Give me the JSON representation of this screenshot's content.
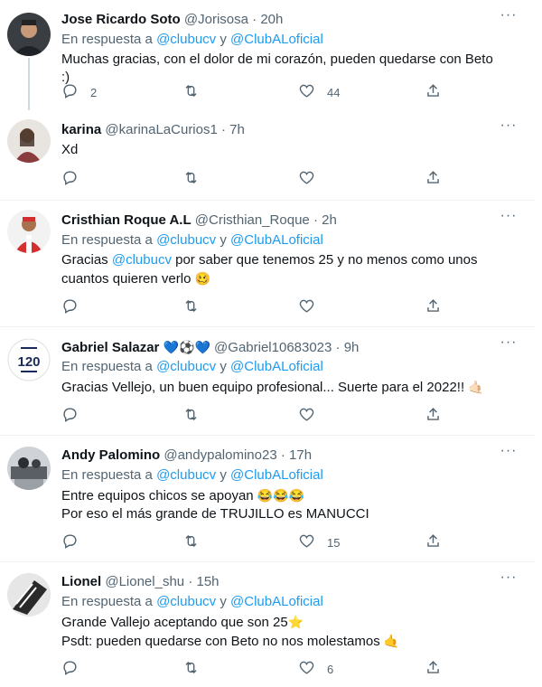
{
  "tweets": [
    {
      "name": "Jose Ricardo Soto",
      "handle": "@Jorisosa",
      "time": "20h",
      "reply_prefix": "En respuesta a",
      "reply_m1": "@clubucv",
      "reply_and": "y",
      "reply_m2": "@ClubALoficial",
      "line1": "Muchas gracias, con el dolor de mi corazón, pueden quedarse con Beto :)",
      "replies": "2",
      "likes": "44"
    },
    {
      "name": "karina",
      "handle": "@karinaLaCurios1",
      "time": "7h",
      "line1": "Xd"
    },
    {
      "name": "Cristhian Roque A.L",
      "handle": "@Cristhian_Roque",
      "time": "2h",
      "reply_prefix": "En respuesta a",
      "reply_m1": "@clubucv",
      "reply_and": "y",
      "reply_m2": "@ClubALoficial",
      "line1_a": "Gracias",
      "line1_m": "@clubucv",
      "line1_b": "por saber que tenemos 25 y no menos como unos",
      "line2": "cuantos quieren verlo",
      "line2_emoji": "🥴"
    },
    {
      "name": "Gabriel Salazar",
      "name_emoji": "💙⚽💙",
      "handle": "@Gabriel10683023",
      "time": "9h",
      "reply_prefix": "En respuesta a",
      "reply_m1": "@clubucv",
      "reply_and": "y",
      "reply_m2": "@ClubALoficial",
      "line1": "Gracias Vellejo, un buen equipo profesional... Suerte para el 2022!!",
      "line1_emoji": "🤙🏻",
      "avatar_text": "120"
    },
    {
      "name": "Andy Palomino",
      "handle": "@andypalomino23",
      "time": "17h",
      "reply_prefix": "En respuesta a",
      "reply_m1": "@clubucv",
      "reply_and": "y",
      "reply_m2": "@ClubALoficial",
      "line1": "Entre equipos chicos se apoyan",
      "line1_emoji": "😂😂😂",
      "line2": "Por eso el más grande de TRUJILLO es MANUCCI",
      "likes": "15"
    },
    {
      "name": "Lionel",
      "handle": "@Lionel_shu",
      "time": "15h",
      "reply_prefix": "En respuesta a",
      "reply_m1": "@clubucv",
      "reply_and": "y",
      "reply_m2": "@ClubALoficial",
      "line1": "Grande Vallejo aceptando que son 25",
      "line1_emoji": "⭐",
      "line2": "Psdt: pueden quedarse con Beto no nos molestamos",
      "line2_emoji": "🤙",
      "likes": "6"
    }
  ],
  "ui": {
    "separator": "·",
    "more_glyph": "···"
  },
  "colors": {
    "accent": "#1d9bf0",
    "secondary_text": "#536471",
    "divider": "#eff3f4"
  },
  "icons": [
    "reply-icon",
    "retweet-icon",
    "like-icon",
    "share-icon",
    "more-icon"
  ]
}
